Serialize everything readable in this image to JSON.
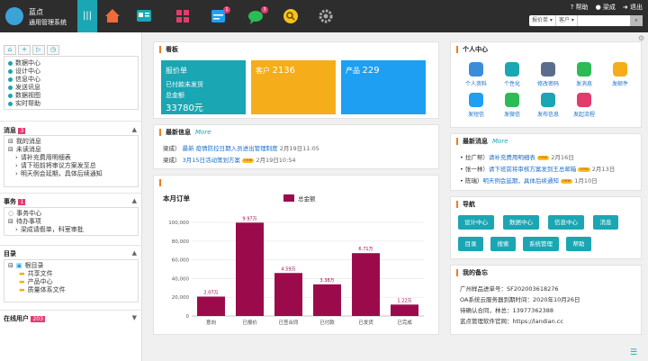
{
  "brand": {
    "line1": "蓝点",
    "line2": "通用管理系统"
  },
  "topnav": {
    "toggle_icon": "menu-icon",
    "badge_calendar": "1",
    "badge_chat": "3"
  },
  "topright": {
    "help": "帮助",
    "user": "梁成",
    "logout": "退出"
  },
  "topsearch": {
    "select1": "报价单",
    "select2": "客户"
  },
  "sidebar": {
    "quick": [
      {
        "label": "数据中心",
        "icon": "database-icon"
      },
      {
        "label": "设计中心",
        "icon": "design-icon"
      },
      {
        "label": "信息中心",
        "icon": "info-icon"
      },
      {
        "label": "发送讯息",
        "icon": "send-icon"
      },
      {
        "label": "数据视图",
        "icon": "chart-icon"
      },
      {
        "label": "实时帮助",
        "icon": "help-icon"
      }
    ],
    "messages": {
      "title": "消息",
      "count": "3",
      "items": [
        "我的消息",
        "未读消息"
      ],
      "sub": [
        "请补充费用明细表",
        "请下班前将审议方案发至总",
        "明天例会延期，具体后续通知"
      ]
    },
    "tasks": {
      "title": "事务",
      "count": "1",
      "items": [
        "事务中心",
        "待办事项"
      ],
      "sub": [
        "梁成请假单，科室审批"
      ]
    },
    "dirs": {
      "title": "目录",
      "root": "根目录",
      "children": [
        "共享文件",
        "产品中心",
        "质量体系文件"
      ]
    },
    "online": {
      "title": "在线用户",
      "count": "203"
    }
  },
  "dashboard": {
    "title": "看板",
    "tiles": [
      {
        "title": "报价单",
        "line1": "已付款未发货",
        "line2": "总金额",
        "value": "33780元",
        "color": "#1aa6b3"
      },
      {
        "title": "客户",
        "value": "2136",
        "color": "#f5ad19"
      },
      {
        "title": "产品",
        "value": "229",
        "color": "#1e9ff2"
      }
    ]
  },
  "latest_info": {
    "title": "最新信息",
    "more": "More",
    "items": [
      {
        "who": "梁成）",
        "tag": "最新",
        "text": "疫情防控日期入员进出管理制度",
        "date": "2月19日11:05"
      },
      {
        "who": "梁成）",
        "tag": "",
        "text": "3月15日活动策划方案",
        "hot": "new",
        "date": "2月19日10:54"
      }
    ]
  },
  "chart_data": {
    "type": "bar",
    "title": "本月订单",
    "legend": "总金额",
    "categories": [
      "意向",
      "已报价",
      "已签合同",
      "已付款",
      "已发货",
      "已完成"
    ],
    "values": [
      20700,
      99700,
      45900,
      33800,
      67100,
      12200
    ],
    "labels": [
      "2.07万",
      "9.97万",
      "4.59万",
      "3.38万",
      "6.71万",
      "1.22万"
    ],
    "ylim": [
      0,
      100000
    ],
    "yticks": [
      "0",
      "20,000",
      "40,000",
      "60,000",
      "80,000",
      "100,000"
    ],
    "color": "#9b0a4a"
  },
  "personal": {
    "title": "个人中心",
    "items": [
      {
        "label": "个人资料",
        "icon": "profile-icon",
        "color": "#3c8dd8"
      },
      {
        "label": "个性化",
        "icon": "customize-icon",
        "color": "#1aa6b3"
      },
      {
        "label": "修改密码",
        "icon": "lock-icon",
        "color": "#5a6e8c"
      },
      {
        "label": "发消息",
        "icon": "message-icon",
        "color": "#2dbb55"
      },
      {
        "label": "发邮件",
        "icon": "mail-icon",
        "color": "#f5ad19"
      },
      {
        "label": "发短信",
        "icon": "sms-icon",
        "color": "#1e9ff2"
      },
      {
        "label": "发微信",
        "icon": "wechat-icon",
        "color": "#2dbb55"
      },
      {
        "label": "发布信息",
        "icon": "publish-icon",
        "color": "#1aa6b3"
      },
      {
        "label": "发起流程",
        "icon": "workflow-icon",
        "color": "#e23b6d"
      }
    ]
  },
  "latest_msgs": {
    "title": "最新消息",
    "more": "More",
    "items": [
      {
        "who": "拉广帮）",
        "text": "请补充费用明细表",
        "hot": "new",
        "date": "2月16日"
      },
      {
        "who": "张一林）",
        "text": "请下班前将审核方案发到王总邮箱",
        "hot": "new",
        "date": "2月13日"
      },
      {
        "who": "陈瑞）",
        "text": "明天例会延期，具体后续通知",
        "hot": "new",
        "date": "1月10日"
      }
    ]
  },
  "nav": {
    "title": "导航",
    "buttons": [
      "设计中心",
      "数据中心",
      "信息中心",
      "消息",
      "目录",
      "搜索",
      "系统管理",
      "帮助"
    ]
  },
  "memo": {
    "title": "我的备忘",
    "lines": [
      "广州样品进单号：SF202003618276",
      "OA系统云服务器到期时间：2020年10月26日",
      "待确认合同，林总：13977362388",
      "蓝点管理软件官网：https://landian.cc"
    ]
  }
}
